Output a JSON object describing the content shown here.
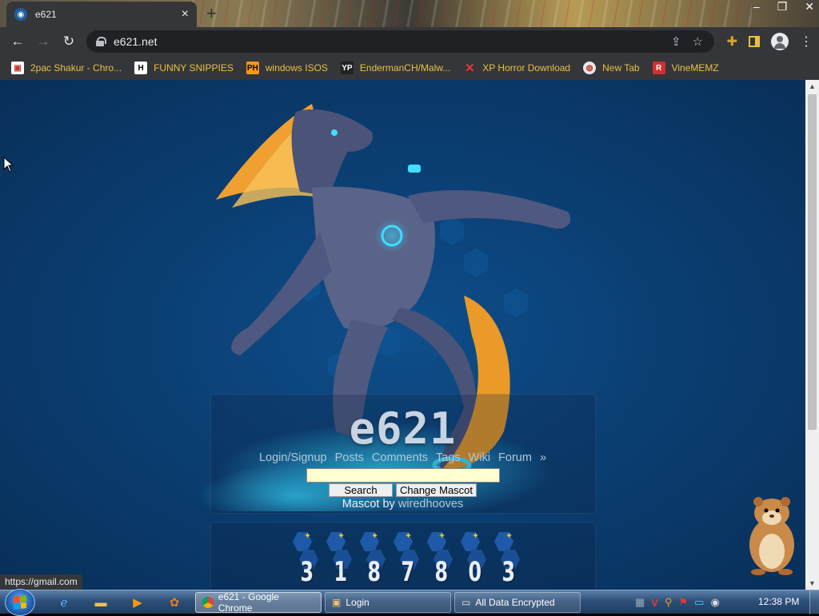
{
  "browser": {
    "tab_title": "e621",
    "url": "e621.net",
    "status_url": "https://gmail.com",
    "bookmarks": [
      {
        "label": "2pac Shakur - Chro...",
        "icon": "gift-icon"
      },
      {
        "label": "FUNNY SNIPPIES",
        "icon": "h-icon"
      },
      {
        "label": "windows ISOS",
        "icon": "ph-icon"
      },
      {
        "label": "EndermanCH/Malw...",
        "icon": "yp-icon"
      },
      {
        "label": "XP Horror Download",
        "icon": "x-icon"
      },
      {
        "label": "New Tab",
        "icon": "globe-icon"
      },
      {
        "label": "VineMEMZ",
        "icon": "r-icon"
      }
    ]
  },
  "page": {
    "logo": "e621",
    "nav": [
      "Login/Signup",
      "Posts",
      "Comments",
      "Tags",
      "Wiki",
      "Forum",
      "»"
    ],
    "search_button": "Search",
    "change_mascot_button": "Change Mascot",
    "mascot_prefix": "Mascot by",
    "mascot_artist": "wiredhooves",
    "counter_digits": [
      "3",
      "1",
      "8",
      "7",
      "8",
      "0",
      "3"
    ]
  },
  "taskbar": {
    "tasks": [
      {
        "label": "e621 - Google Chrome",
        "icon": "chrome-icon",
        "active": true
      },
      {
        "label": "Login",
        "icon": "login-icon",
        "active": false
      },
      {
        "label": "All Data Encrypted",
        "icon": "window-icon",
        "active": false
      }
    ],
    "clock": "12:38 PM"
  },
  "colors": {
    "page_bg": "#0b3f74",
    "link": "#b3c6d8",
    "bookmark_text": "#e8c040",
    "chrome_bg": "#35363a"
  }
}
